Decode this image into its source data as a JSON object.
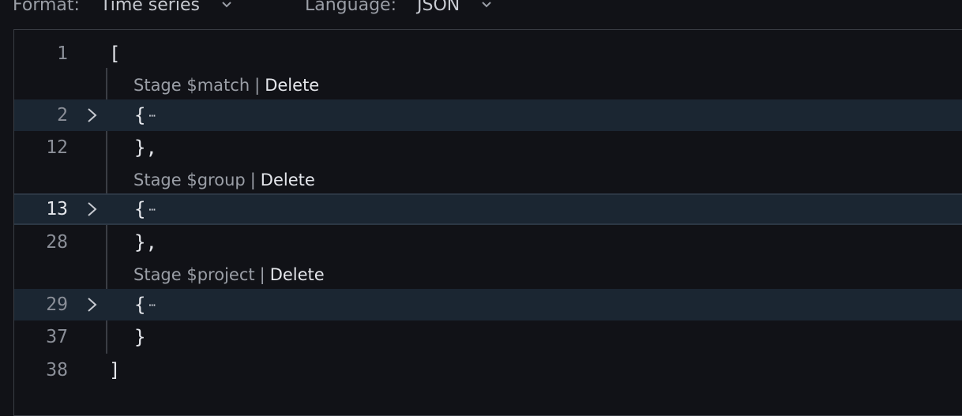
{
  "toolbar": {
    "format_label": "Format:",
    "format_value": "Time series",
    "language_label": "Language:",
    "language_value": "JSON"
  },
  "editor": {
    "lines": [
      {
        "num": "1",
        "text": "["
      },
      {
        "num": "2",
        "text": "{"
      },
      {
        "num": "12",
        "text": "},"
      },
      {
        "num": "13",
        "text": "{"
      },
      {
        "num": "28",
        "text": "},"
      },
      {
        "num": "29",
        "text": "{"
      },
      {
        "num": "37",
        "text": "}"
      },
      {
        "num": "38",
        "text": "]"
      }
    ],
    "ellipsis": "⋯",
    "stages": [
      {
        "label": "Stage $match",
        "separator": "|",
        "action": "Delete"
      },
      {
        "label": "Stage $group",
        "separator": "|",
        "action": "Delete"
      },
      {
        "label": "Stage $project",
        "separator": "|",
        "action": "Delete"
      }
    ]
  }
}
